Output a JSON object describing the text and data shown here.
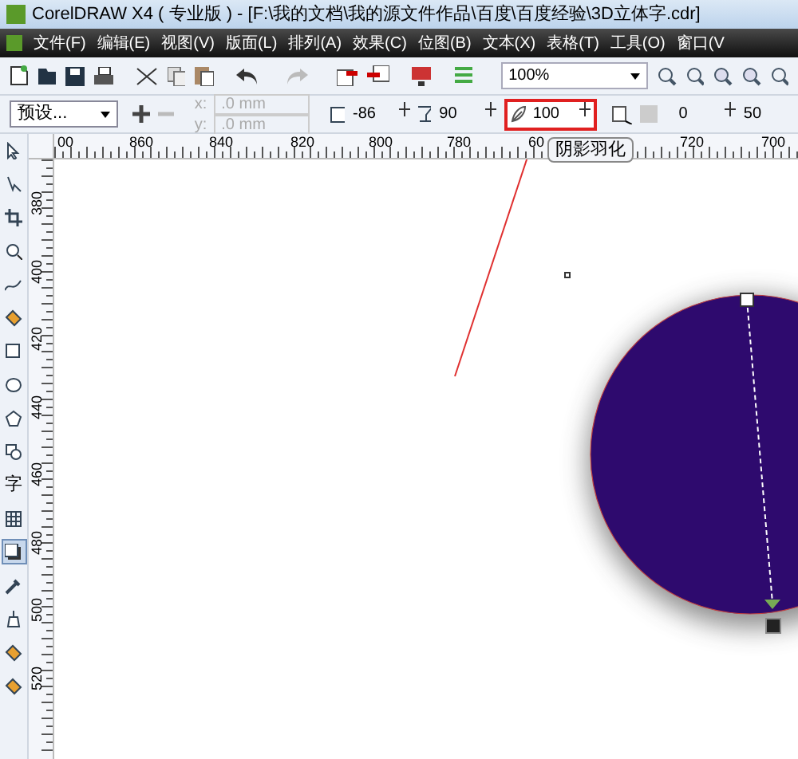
{
  "window": {
    "title": "CorelDRAW X4 ( 专业版 ) - [F:\\我的文档\\我的源文件作品\\百度\\百度经验\\3D立体字.cdr]"
  },
  "menu": [
    "文件(F)",
    "编辑(E)",
    "视图(V)",
    "版面(L)",
    "排列(A)",
    "效果(C)",
    "位图(B)",
    "文本(X)",
    "表格(T)",
    "工具(O)",
    "窗口(V"
  ],
  "toolbar": {
    "zoom": "100%"
  },
  "property_bar": {
    "preset": "预设...",
    "x": ".0 mm",
    "y": ".0 mm",
    "x_label": "x:",
    "y_label": "y:",
    "direction": "-86",
    "opacity": "90",
    "feather": "100",
    "fade": "0",
    "stretch": "50",
    "tooltip": "阴影羽化"
  },
  "ruler": {
    "horizontal": [
      "00",
      "860",
      "840",
      "820",
      "800",
      "780",
      "60",
      "720",
      "700"
    ],
    "vertical": [
      "380",
      "400",
      "420",
      "440",
      "460",
      "480",
      "500",
      "520"
    ]
  },
  "tools": [
    {
      "kind": "pointer",
      "selected": false
    },
    {
      "kind": "node",
      "selected": false
    },
    {
      "kind": "crop",
      "selected": false
    },
    {
      "kind": "magnifier",
      "selected": false
    },
    {
      "kind": "curve",
      "selected": false
    },
    {
      "kind": "bucket",
      "selected": false
    },
    {
      "kind": "rectangle",
      "selected": false
    },
    {
      "kind": "ellipse",
      "selected": false
    },
    {
      "kind": "polygon",
      "selected": false
    },
    {
      "kind": "shapes",
      "selected": false
    },
    {
      "kind": "text",
      "label": "字",
      "selected": false
    },
    {
      "kind": "grid",
      "selected": false
    },
    {
      "kind": "shadow",
      "selected": true
    },
    {
      "kind": "eyedropper",
      "selected": false
    },
    {
      "kind": "pen",
      "selected": false
    },
    {
      "kind": "bucket",
      "selected": false
    },
    {
      "kind": "bucket",
      "selected": false
    }
  ]
}
